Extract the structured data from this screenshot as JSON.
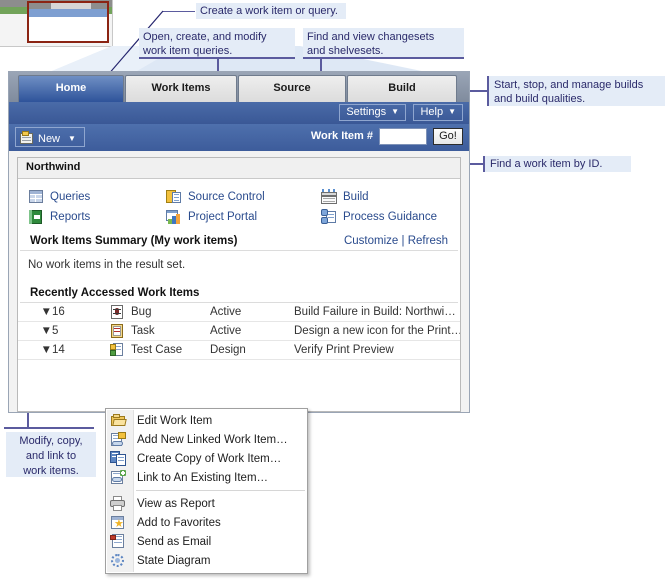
{
  "thumbnail": {
    "name": "page-thumbnail"
  },
  "callouts": [
    {
      "id": "new-callout",
      "text": "Create a work item or query."
    },
    {
      "id": "workitems-callout",
      "text": "Open, create, and modify\nwork item queries."
    },
    {
      "id": "source-callout",
      "text": "Find and view changesets\nand shelvesets."
    },
    {
      "id": "build-callout",
      "text": "Start, stop, and manage builds\nand build qualities."
    },
    {
      "id": "findid-callout",
      "text": "Find a work item by ID."
    },
    {
      "id": "ctx-callout",
      "text": "Modify, copy,\nand link to\nwork items."
    }
  ],
  "app": {
    "tabs": [
      {
        "label": "Home",
        "active": true
      },
      {
        "label": "Work Items",
        "active": false
      },
      {
        "label": "Source",
        "active": false
      },
      {
        "label": "Build",
        "active": false
      }
    ],
    "command_bar": {
      "settings_label": "Settings",
      "help_label": "Help",
      "carat": "▼"
    },
    "toolbar": {
      "new_label": "New",
      "new_carat": "▼",
      "new_icon": "new-work-item-icon",
      "work_item_label": "Work Item #",
      "work_item_value": "",
      "work_item_placeholder": "",
      "go_label": "Go!"
    },
    "project": {
      "name": "Northwind"
    },
    "quick_links": [
      {
        "label": "Queries",
        "icon": "queries-icon"
      },
      {
        "label": "Source Control",
        "icon": "source-control-icon"
      },
      {
        "label": "Build",
        "icon": "build-icon"
      },
      {
        "label": "Reports",
        "icon": "reports-icon"
      },
      {
        "label": "Project Portal",
        "icon": "project-portal-icon"
      },
      {
        "label": "Process Guidance",
        "icon": "process-guidance-icon"
      }
    ],
    "summary": {
      "title": "Work Items Summary (My work items)",
      "customize_label": "Customize",
      "separator": "|",
      "refresh_label": "Refresh",
      "empty_message": "No work items in the result set."
    },
    "recent": {
      "title": "Recently Accessed Work Items",
      "expander": "▼",
      "rows": [
        {
          "id": "16",
          "type": "Bug",
          "state": "Active",
          "title": "Build Failure in Build: Northwi…",
          "icon": "bug-icon"
        },
        {
          "id": "5",
          "type": "Task",
          "state": "Active",
          "title": "Design a new icon for the Print…",
          "icon": "task-icon"
        },
        {
          "id": "14",
          "type": "Test Case",
          "state": "Design",
          "title": "Verify Print Preview",
          "icon": "test-case-icon"
        }
      ]
    }
  },
  "context_menu": {
    "groups": [
      [
        {
          "label": "Edit Work Item",
          "icon": "open-folder-icon"
        },
        {
          "label": "Add New Linked Work Item…",
          "icon": "add-linked-item-icon"
        },
        {
          "label": "Create Copy of Work Item…",
          "icon": "copy-icon"
        },
        {
          "label": "Link to An Existing Item…",
          "icon": "link-item-icon"
        }
      ],
      [
        {
          "label": "View as Report",
          "icon": "printer-icon"
        },
        {
          "label": "Add to Favorites",
          "icon": "favorites-star-icon"
        },
        {
          "label": "Send as Email",
          "icon": "email-icon"
        },
        {
          "label": "State Diagram",
          "icon": "state-diagram-icon"
        }
      ]
    ]
  },
  "colors": {
    "callout_bg": "#e4ecf7",
    "callout_text": "#2a2a6a",
    "callout_rule": "#5b5b9e",
    "tab_active_from": "#6f8fc4",
    "tab_active_to": "#2e539a",
    "link": "#2a4b8d",
    "thumb_highlight": "#8b2413"
  }
}
